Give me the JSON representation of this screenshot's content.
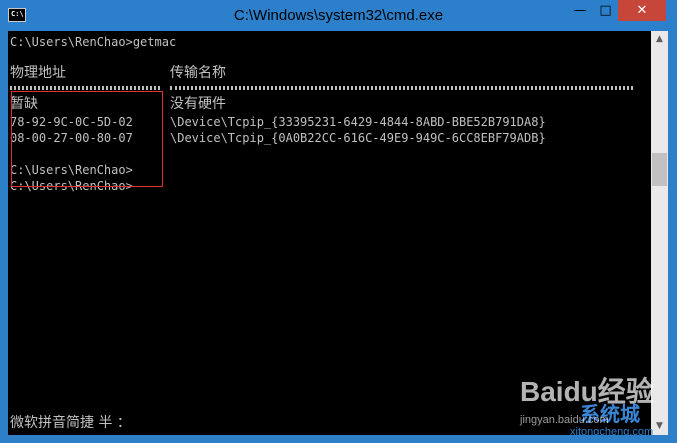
{
  "window": {
    "title": "C:\\Windows\\system32\\cmd.exe",
    "icon_label": "C:\\",
    "controls": {
      "minimize": "—",
      "maximize": "□",
      "close": "✕"
    }
  },
  "console": {
    "prompt_command": "C:\\Users\\RenChao>getmac",
    "header_col1": "物理地址",
    "header_col2": "传输名称",
    "rows": [
      {
        "mac": "暂缺",
        "transport": "没有硬件"
      },
      {
        "mac": "78-92-9C-0C-5D-02",
        "transport": "\\Device\\Tcpip_{33395231-6429-4844-8ABD-BBE52B791DA8}"
      },
      {
        "mac": "08-00-27-00-80-07",
        "transport": "\\Device\\Tcpip_{0A0B22CC-616C-49E9-949C-6CC8EBF79ADB}"
      }
    ],
    "prompt_1": "C:\\Users\\RenChao>",
    "prompt_2": "C:\\Users\\RenChao>",
    "ime_status": "微软拼音简捷 半 ："
  },
  "watermark": {
    "brand_text": "Baidu经验",
    "site_name": "系统城",
    "site_url": "xitongcheng.com",
    "jingyan_url": "jingyan.baidu.com"
  },
  "colors": {
    "title_bar": "#2b7fcb",
    "console_bg": "#000000",
    "console_fg": "#c0c0c0",
    "close_button": "#c7463a",
    "highlight_border": "#e03030"
  }
}
